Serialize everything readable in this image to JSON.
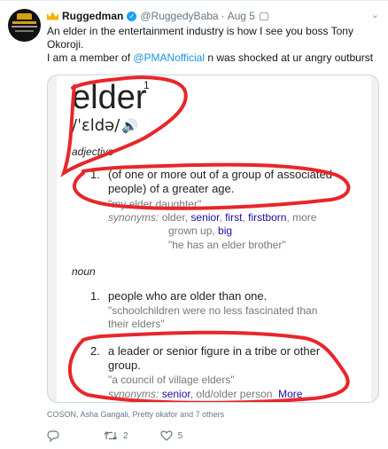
{
  "tweet": {
    "author_name": "Ruggedman",
    "handle": "@RuggedyBaba",
    "separator": "·",
    "date": "Aug 5",
    "text_line1": "An elder in the entertainment industry is how I see you boss Tony",
    "text_line2": "Okoroji.",
    "text_line3_before": "I am a member of ",
    "text_line3_mention": "@PMANofficial",
    "text_line3_after": " n was shocked at ur angry outburst",
    "likers": "COSON, Asha Gangali, Pretty okafor and 7 others",
    "reply_count": "",
    "retweet_count": "2",
    "like_count": "5"
  },
  "definition": {
    "word": "elder",
    "superscript": "1",
    "pronunciation": "/ˈɛldə/",
    "pos_adjective": "adjective",
    "adj_sense_number": "1.",
    "adj_def_line1": "(of one or more out of a group of associated",
    "adj_def_line2": "people) of a greater age.",
    "adj_example": "\"my elder daughter\"",
    "adj_synonyms_label": "synonyms:",
    "adj_syn_plain1": " older, ",
    "adj_syn_link1": "senior",
    "adj_syn_sep1": ", ",
    "adj_syn_link2": "first",
    "adj_syn_sep2": ", ",
    "adj_syn_link3": "firstborn",
    "adj_syn_plain2": ", more",
    "adj_syn_line2_plain": "grown up, ",
    "adj_syn_link4": "big",
    "adj_syn_example": "\"he has an elder brother\"",
    "pos_noun": "noun",
    "noun1_number": "1.",
    "noun1_def": "people who are older than one.",
    "noun1_example_line1": "\"schoolchildren were no less fascinated than",
    "noun1_example_line2": "their elders\"",
    "noun2_number": "2.",
    "noun2_def_line1": "a leader or senior figure in a tribe or other",
    "noun2_def_line2": "group.",
    "noun2_example": "\"a council of village elders\"",
    "noun2_synonyms_label": "synonyms:",
    "noun2_syn_link": "senior",
    "noun2_syn_plain": ", old/older person",
    "more_label": "More"
  },
  "colors": {
    "mention": "#1b95e0",
    "verified": "#1da1f2",
    "annotation_red": "#e8262a"
  },
  "icons": [
    "verified-badge-icon",
    "retweet-indicator-icon",
    "chevron-down-icon",
    "speaker-icon",
    "reply-icon",
    "retweet-icon",
    "like-icon"
  ]
}
